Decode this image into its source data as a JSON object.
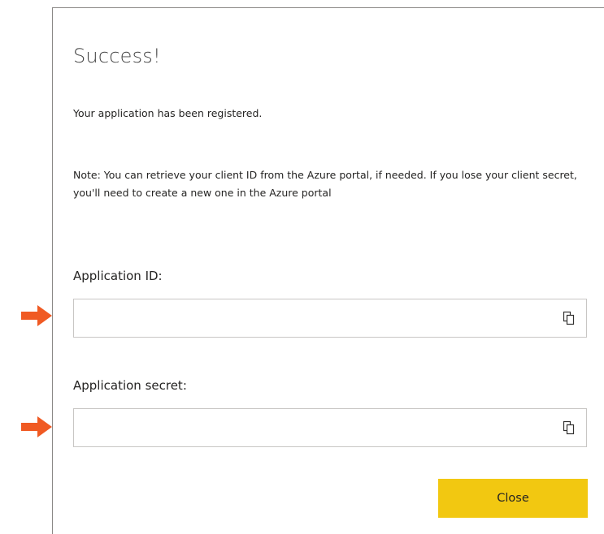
{
  "dialog": {
    "title": "Success!",
    "message": "Your application has been registered.",
    "note": "Note: You can retrieve your client ID from the Azure portal, if needed. If you lose your client secret, you'll need to create a new one in the Azure portal",
    "app_id": {
      "label": "Application ID:",
      "value": "",
      "copy_icon": "copy-icon"
    },
    "app_secret": {
      "label": "Application secret:",
      "value": "",
      "copy_icon": "copy-icon"
    },
    "close_label": "Close"
  },
  "annotations": {
    "arrow_color": "#f05a23",
    "arrow_icon": "arrow-right-icon"
  },
  "colors": {
    "button_bg": "#f2c811",
    "border": "#c8c6c4"
  }
}
